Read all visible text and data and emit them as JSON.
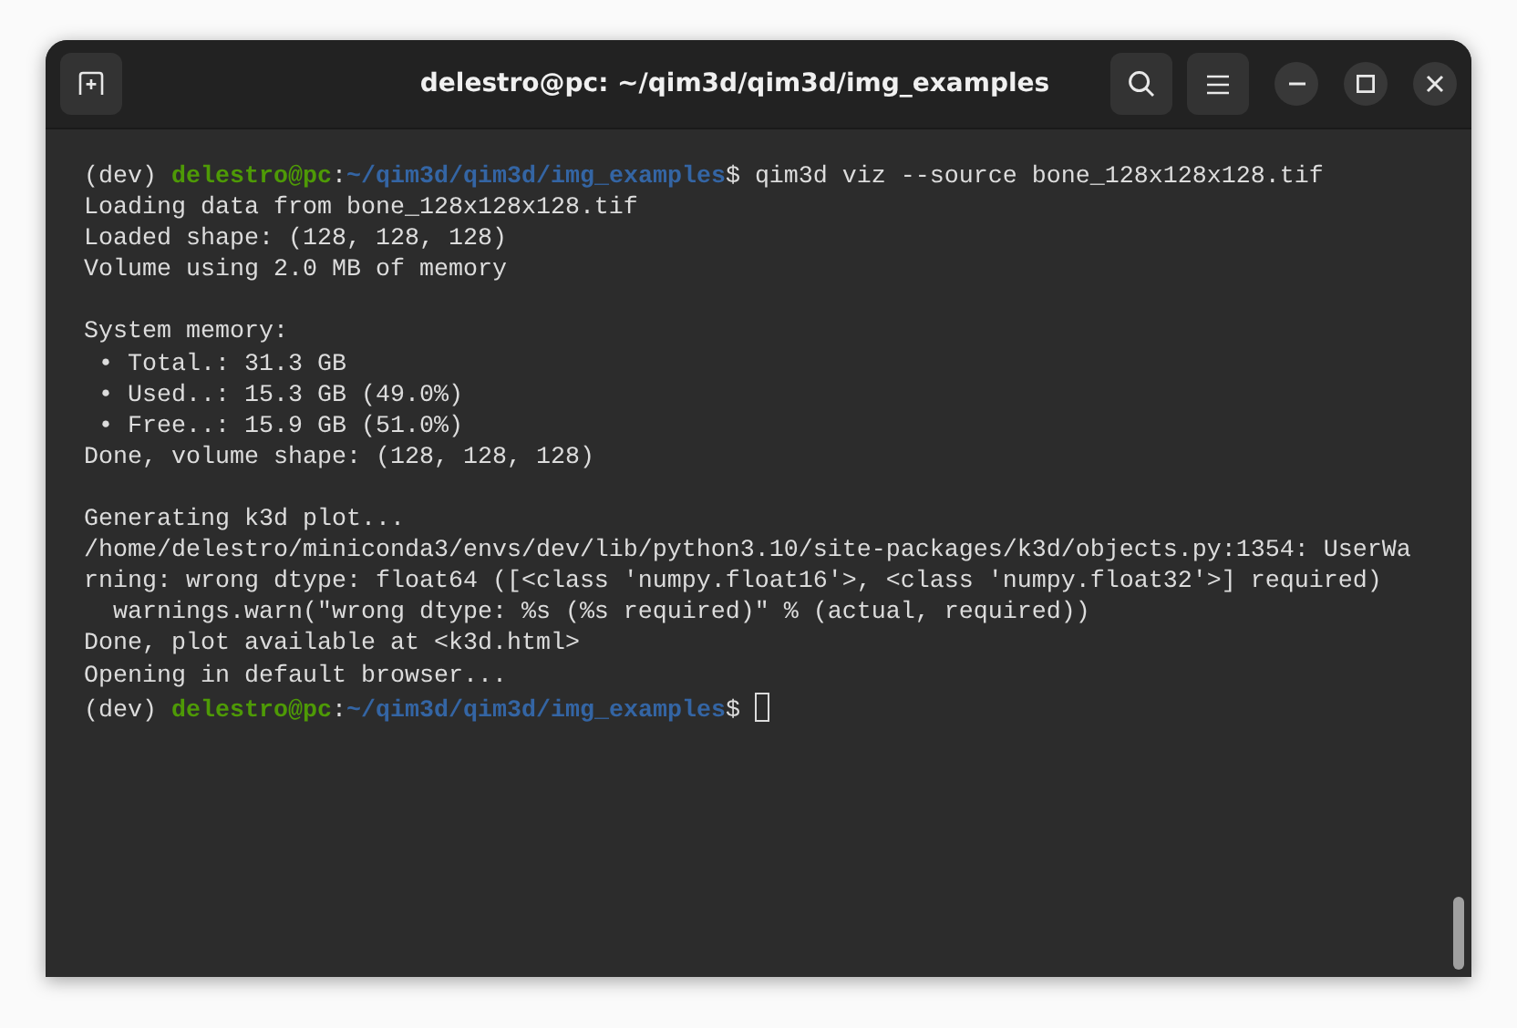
{
  "window": {
    "title": "delestro@pc: ~/qim3d/qim3d/img_examples"
  },
  "terminal": {
    "lines": [
      {
        "kind": "prompt",
        "env": "(dev)",
        "user": "delestro@pc",
        "separator": ":",
        "path": "~/qim3d/qim3d/img_examples",
        "prompt_char": "$",
        "command": "qim3d viz --source bone_128x128x128.tif"
      },
      {
        "kind": "output",
        "text": "Loading data from bone_128x128x128.tif"
      },
      {
        "kind": "output",
        "text": "Loaded shape: (128, 128, 128)"
      },
      {
        "kind": "output",
        "text": "Volume using 2.0 MB of memory"
      },
      {
        "kind": "blank"
      },
      {
        "kind": "output",
        "text": "System memory:"
      },
      {
        "kind": "output",
        "text": " • Total.: 31.3 GB"
      },
      {
        "kind": "output",
        "text": " • Used..: 15.3 GB (49.0%)"
      },
      {
        "kind": "output",
        "text": " • Free..: 15.9 GB (51.0%)"
      },
      {
        "kind": "output",
        "text": "Done, volume shape: (128, 128, 128)"
      },
      {
        "kind": "blank"
      },
      {
        "kind": "output",
        "text": "Generating k3d plot..."
      },
      {
        "kind": "output",
        "text": "/home/delestro/miniconda3/envs/dev/lib/python3.10/site-packages/k3d/objects.py:1354: UserWa"
      },
      {
        "kind": "output",
        "text": "rning: wrong dtype: float64 ([<class 'numpy.float16'>, <class 'numpy.float32'>] required)"
      },
      {
        "kind": "output",
        "text": "  warnings.warn(\"wrong dtype: %s (%s required)\" % (actual, required))"
      },
      {
        "kind": "output",
        "text": "Done, plot available at <k3d.html>"
      },
      {
        "kind": "output",
        "text": "Opening in default browser..."
      },
      {
        "kind": "prompt",
        "env": "(dev)",
        "user": "delestro@pc",
        "separator": ":",
        "path": "~/qim3d/qim3d/img_examples",
        "prompt_char": "$",
        "cursor": true
      }
    ]
  }
}
